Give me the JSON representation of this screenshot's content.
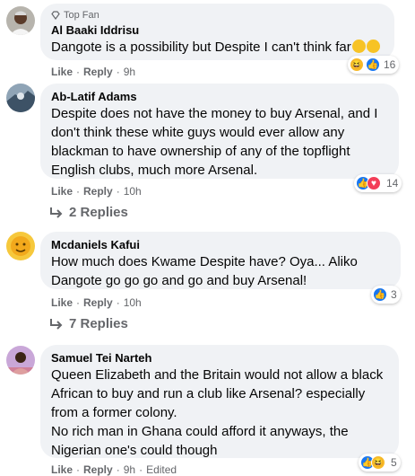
{
  "comments": [
    {
      "badge": "Top Fan",
      "name": "Al Baaki Iddrisu",
      "text": "Dangote is a possibility but Despite I can't think far",
      "like": "Like",
      "reply": "Reply",
      "time": "9h",
      "reaction_count": "16",
      "reactions": [
        "haha",
        "like"
      ],
      "emojis": [
        "grinning-face",
        "grinning-face"
      ]
    },
    {
      "name": "Ab-Latif Adams",
      "text": "Despite does not have the money to buy Arsenal, and I don't think these white guys would ever allow any blackman to have ownership of any of the topflight English clubs, much more Arsenal.",
      "like": "Like",
      "reply": "Reply",
      "time": "10h",
      "reaction_count": "14",
      "reactions": [
        "like",
        "love"
      ],
      "replies_label": "2 Replies"
    },
    {
      "name": "Mcdaniels Kafui",
      "text": "How much does Kwame Despite have? Oya... Aliko Dangote go go go and go and buy Arsenal!",
      "like": "Like",
      "reply": "Reply",
      "time": "10h",
      "reaction_count": "3",
      "reactions": [
        "like"
      ],
      "replies_label": "7 Replies"
    },
    {
      "name": "Samuel Tei Narteh",
      "text": "Queen Elizabeth and the Britain would not allow a black African to buy and run a club like Arsenal? especially from a former colony.\nNo rich man in Ghana could afford it anyways, the Nigerian one's could though",
      "like": "Like",
      "reply": "Reply",
      "time": "9h",
      "edited": "Edited",
      "reaction_count": "5",
      "reactions": [
        "like",
        "haha"
      ]
    }
  ],
  "colors": {
    "bubble": "#f0f2f5",
    "meta": "#65676b",
    "like": "#1877f2",
    "love": "#f33e58",
    "haha": "#f7b928"
  }
}
